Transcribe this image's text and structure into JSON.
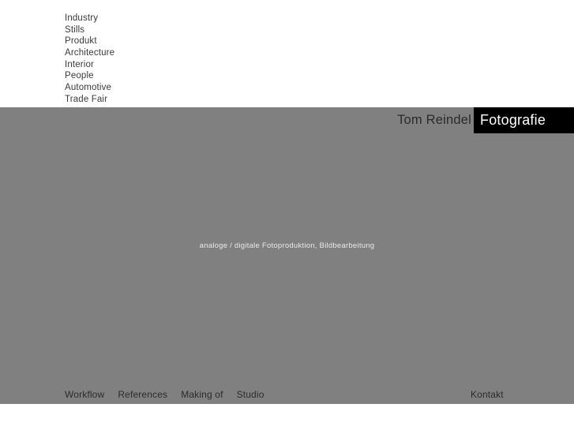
{
  "colors": {
    "page_background": "#ffffff",
    "stage_gray": "#808080",
    "brand_box_black": "#000000",
    "nav_text": "#3a3a3a",
    "tagline_text": "#e9e9e9",
    "brand_word_text": "#ffffff"
  },
  "top_nav": {
    "items": [
      {
        "label": "Industry"
      },
      {
        "label": "Stills"
      },
      {
        "label": "Produkt"
      },
      {
        "label": "Architecture"
      },
      {
        "label": "Interior"
      },
      {
        "label": "People"
      },
      {
        "label": "Automotive"
      },
      {
        "label": "Trade Fair"
      }
    ]
  },
  "brand": {
    "name": "Tom Reindel",
    "word": "Fotografie"
  },
  "stage": {
    "tagline": "analoge / digitale Fotoproduktion, Bildbearbeitung"
  },
  "footer": {
    "left_items": [
      {
        "label": "Workflow"
      },
      {
        "label": "References"
      },
      {
        "label": "Making of"
      },
      {
        "label": "Studio"
      }
    ],
    "right_items": [
      {
        "label": "Kontakt"
      }
    ]
  }
}
